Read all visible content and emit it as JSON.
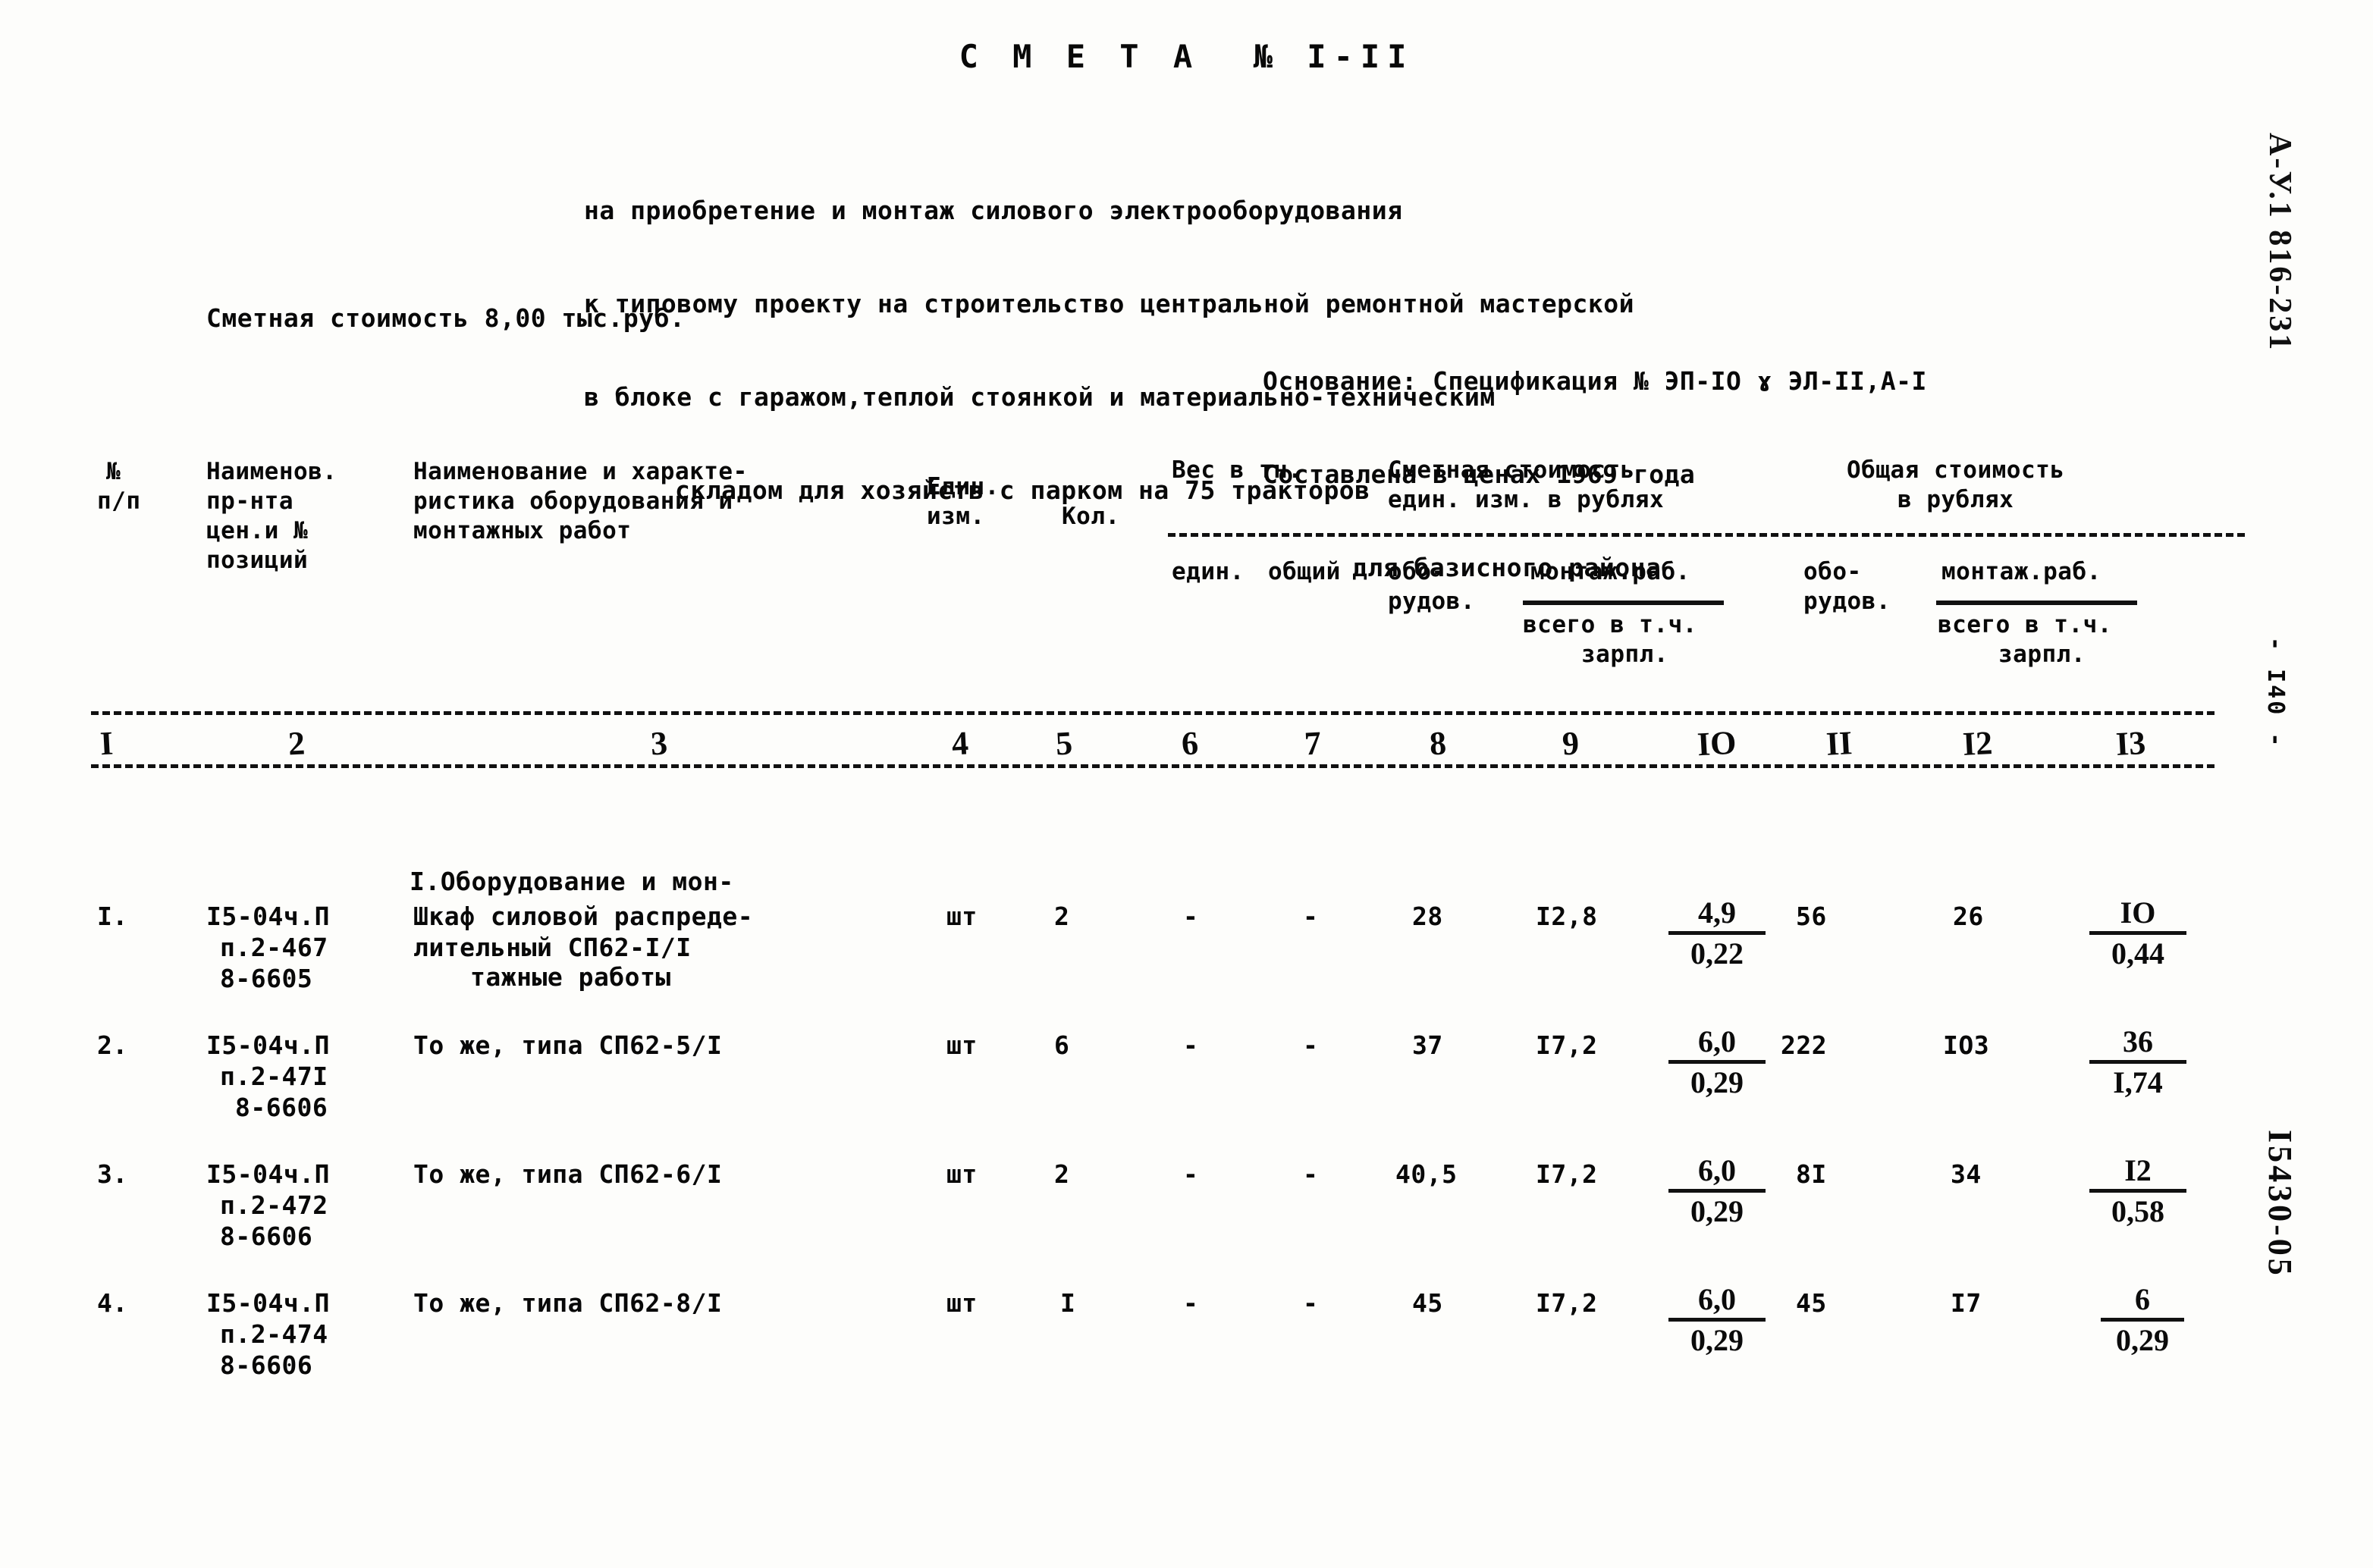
{
  "document": {
    "title": "С М Е Т А  № I-II",
    "subtitle_lines": [
      "на приобретение и монтаж силового электрооборудования",
      "к типовому проекту на строительство центральной ремонтной мастерской",
      "в блоке с гаражом,теплой стоянкой и материально-техническим",
      "складом для хозяйств с парком на 75 тракторов"
    ],
    "cost_line": "Сметная стоимость 8,00 тыс.руб.",
    "basis_lines": [
      "Основание: Спецификация № ЭП-IO ɤ ЭЛ-II,А-I",
      "Составлена в ценах 1969 года",
      "для базисного района"
    ],
    "margin": {
      "archive_code": "А-У.1 816-231",
      "page_number": "- I40 -",
      "sheet_code": "I5430-05"
    }
  },
  "table": {
    "header": {
      "col1": [
        "№",
        "п/п"
      ],
      "col2": [
        "Наименов.",
        "пр-нта",
        "цен.и №",
        "позиций"
      ],
      "col3": [
        "Наименование и характе-",
        "ристика оборудования и",
        "монтажных работ"
      ],
      "col4": [
        "Един.",
        "изм."
      ],
      "col5": [
        "Кол."
      ],
      "weight_group": "Вес в тн.",
      "col6": "един.",
      "col7": "общий",
      "unit_cost_group": [
        "Сметная стоимость",
        "един. изм. в рублях"
      ],
      "col8": [
        "обо-",
        "рудов."
      ],
      "col9": [
        "монтаж.раб.",
        "всего в т.ч.",
        "зарпл."
      ],
      "total_cost_group": [
        "Общая стоимость",
        "в рублях"
      ],
      "col10_11": [
        "обо-",
        "рудов."
      ],
      "col12_13": [
        "монтаж.раб.",
        "всего в т.ч.",
        "зарпл."
      ]
    },
    "column_numbers": [
      "I",
      "2",
      "3",
      "4",
      "5",
      "6",
      "7",
      "8",
      "9",
      "IO",
      "II",
      "I2",
      "I3"
    ],
    "section_title": [
      "I.Оборудование и мон-",
      "тажные работы"
    ],
    "rows": [
      {
        "num": "I.",
        "price_ref": [
          "I5-04ч.П",
          "п.2-467",
          "8-6605"
        ],
        "description": [
          "Шкаф силовой распреде-",
          "лительный СП62-I/I"
        ],
        "unit": "шт",
        "qty": "2",
        "weight_unit": "-",
        "weight_total": "-",
        "unit_equip": "28",
        "unit_install": "I2,8",
        "unit_install_work_num": "4,9",
        "unit_install_work_den": "0,22",
        "total_equip": "56",
        "total_install": "26",
        "total_install_work_num": "IO",
        "total_install_work_den": "0,44"
      },
      {
        "num": "2.",
        "price_ref": [
          "I5-04ч.П",
          "п.2-47I",
          "8-6606"
        ],
        "description": [
          "То же, типа СП62-5/I"
        ],
        "unit": "шт",
        "qty": "6",
        "weight_unit": "-",
        "weight_total": "-",
        "unit_equip": "37",
        "unit_install": "I7,2",
        "unit_install_work_num": "6,0",
        "unit_install_work_den": "0,29",
        "total_equip": "222",
        "total_install": "IO3",
        "total_install_work_num": "36",
        "total_install_work_den": "I,74"
      },
      {
        "num": "3.",
        "price_ref": [
          "I5-04ч.П",
          "п.2-472",
          "8-6606"
        ],
        "description": [
          "То же, типа СП62-6/I"
        ],
        "unit": "шт",
        "qty": "2",
        "weight_unit": "-",
        "weight_total": "-",
        "unit_equip": "40,5",
        "unit_install": "I7,2",
        "unit_install_work_num": "6,0",
        "unit_install_work_den": "0,29",
        "total_equip": "8I",
        "total_install": "34",
        "total_install_work_num": "I2",
        "total_install_work_den": "0,58"
      },
      {
        "num": "4.",
        "price_ref": [
          "I5-04ч.П",
          "п.2-474",
          "8-6606"
        ],
        "description": [
          "То же, типа СП62-8/I"
        ],
        "unit": "шт",
        "qty": "I",
        "weight_unit": "-",
        "weight_total": "-",
        "unit_equip": "45",
        "unit_install": "I7,2",
        "unit_install_work_num": "6,0",
        "unit_install_work_den": "0,29",
        "total_equip": "45",
        "total_install": "I7",
        "total_install_work_num": "6",
        "total_install_work_den": "0,29"
      }
    ]
  }
}
